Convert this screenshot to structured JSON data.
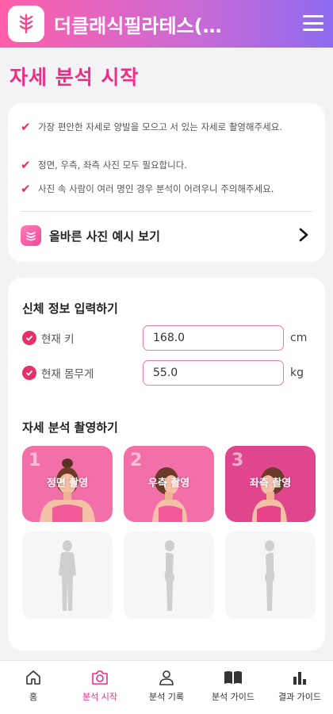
{
  "header": {
    "title": "더클래식필라테스(…"
  },
  "page_title": "자세 분석 시작",
  "tips": [
    "가장 편안한 자세로 양발을 모으고 서 있는 자세로 촬영해주세요.",
    "정면, 우측, 좌측 사진 모두 필요합니다.",
    "사진 속 사람이 여러 명인 경우 분석이 어려우니 주의해주세요."
  ],
  "example_link": "올바른 사진 예시 보기",
  "body_info": {
    "title": "신체 정보 입력하기",
    "height": {
      "label": "현재 키",
      "value": "168.0",
      "unit": "cm"
    },
    "weight": {
      "label": "현재 몸무게",
      "value": "55.0",
      "unit": "kg"
    }
  },
  "capture": {
    "title": "자세 분석 촬영하기",
    "tiles": [
      {
        "num": "1",
        "label": "정면 촬영"
      },
      {
        "num": "2",
        "label": "우측 촬영"
      },
      {
        "num": "3",
        "label": "좌측 촬영"
      }
    ]
  },
  "nav": [
    {
      "label": "홈",
      "icon": "home-icon"
    },
    {
      "label": "분석 시작",
      "icon": "camera-icon",
      "active": true
    },
    {
      "label": "분석 기록",
      "icon": "person-icon"
    },
    {
      "label": "분석 가이드",
      "icon": "book-icon"
    },
    {
      "label": "결과 가이드",
      "icon": "bar-chart-icon"
    }
  ],
  "colors": {
    "brand_pink": "#ec2f84",
    "check_red": "#e02e66",
    "header_gradient_start": "#ff5fa8",
    "header_gradient_end": "#8d6bf0"
  }
}
